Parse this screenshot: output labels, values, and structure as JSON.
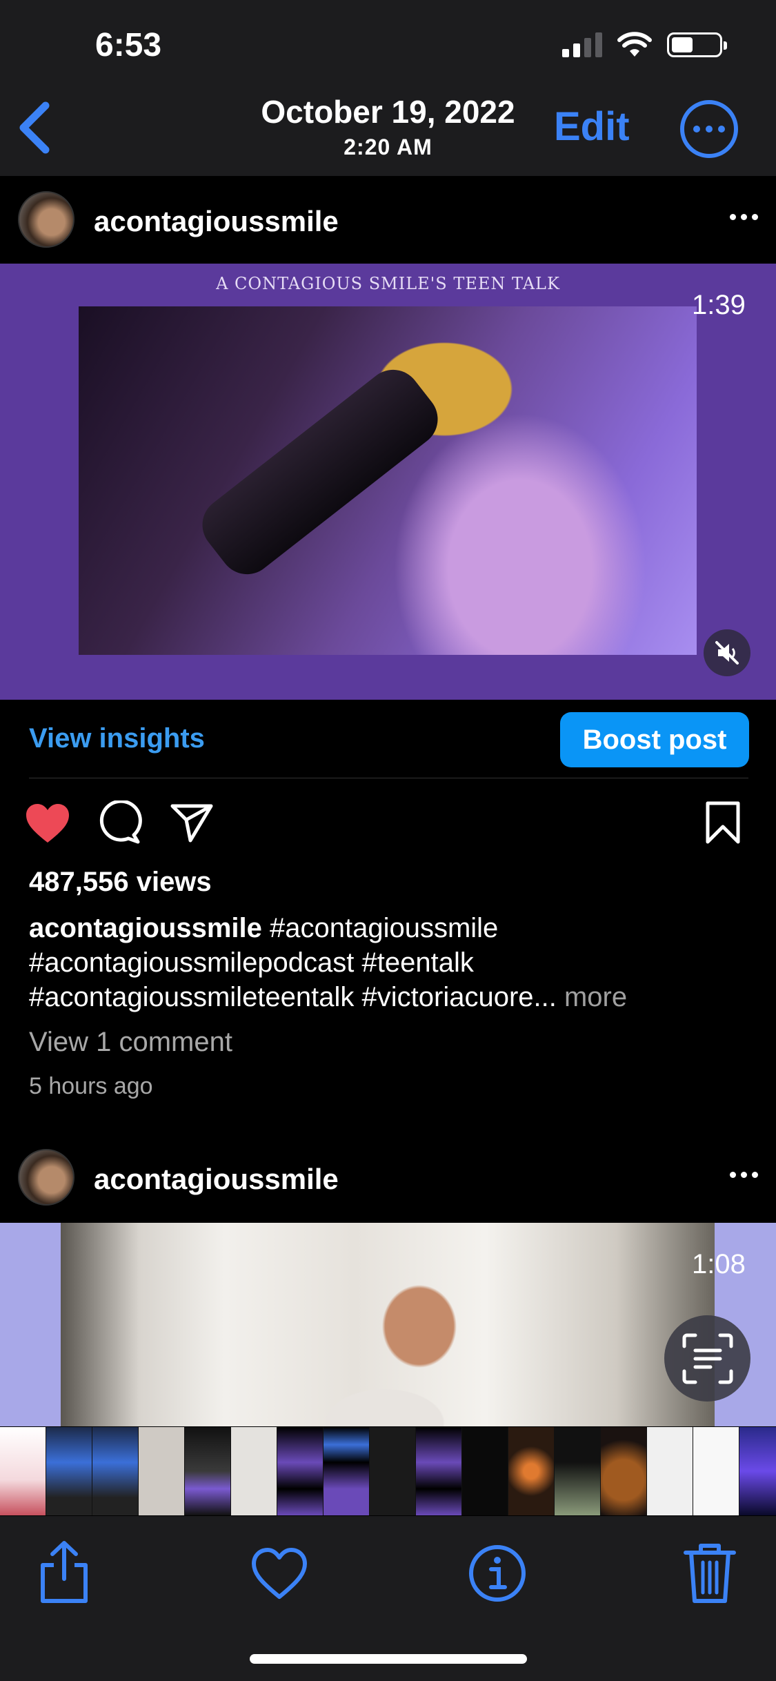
{
  "status_bar": {
    "time": "6:53"
  },
  "header": {
    "date": "October 19, 2022",
    "time": "2:20 AM",
    "edit_label": "Edit"
  },
  "posts": [
    {
      "username": "acontagioussmile",
      "media_caption": "A CONTAGIOUS SMILE'S TEEN TALK",
      "duration": "1:39",
      "view_insights_label": "View insights",
      "boost_label": "Boost post",
      "views": "487,556 views",
      "caption_user": "acontagioussmile",
      "caption_text": " #acontagioussmile #acontagioussmilepodcast #teentalk #acontagioussmileteentalk #victoriacuore...",
      "caption_more": " more",
      "view_comments": "View 1 comment",
      "time_ago": "5 hours ago"
    },
    {
      "username": "acontagioussmile",
      "duration": "1:08"
    }
  ],
  "icons": {
    "back": "chevron-left-icon",
    "more": "ellipsis-circle-icon",
    "like": "heart-filled-icon",
    "comment": "comment-icon",
    "share": "paper-plane-icon",
    "save": "bookmark-icon",
    "mute": "speaker-muted-icon",
    "scan": "live-text-icon",
    "toolbar": [
      "share-icon",
      "heart-outline-icon",
      "info-icon",
      "trash-icon"
    ]
  },
  "colors": {
    "accent": "#3b82f6",
    "boost": "#0a95f6",
    "like": "#ed4956",
    "media_bg": "#5b3a9c"
  }
}
